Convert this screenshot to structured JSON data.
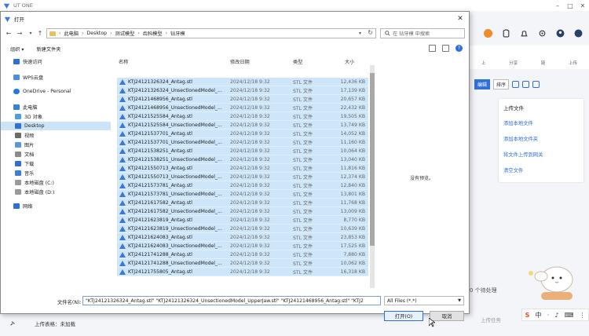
{
  "app": {
    "title": "UT ONE",
    "nav_items": [
      "上",
      "分享",
      "链",
      "上传"
    ],
    "edit_label": "编辑",
    "sort_label": "排序",
    "upload_panel": {
      "title": "上传文件",
      "links": [
        "添加本地文件",
        "添加本地文件夹",
        "将文件上传到网关",
        "清空文件"
      ]
    },
    "status_right": "0 个待处理",
    "bottom_text": "上传表格：未加载",
    "bottom_right": "上传任务",
    "ime": [
      "S",
      "中",
      "·",
      "♪",
      "⌨",
      "⋮"
    ]
  },
  "dialog": {
    "title": "打开",
    "breadcrumbs": [
      "此电脑",
      "Desktop",
      "测试模型",
      "齿科模型",
      "钻牙模"
    ],
    "search_placeholder": "在 钻牙模 中搜索",
    "organize": "组织 ▾",
    "new_folder": "新建文件夹",
    "nav": [
      {
        "label": "快速访问",
        "icon": "star"
      },
      {
        "label": "WPS云盘",
        "icon": "cloud"
      },
      {
        "label": "OneDrive - Personal",
        "icon": "onedrive"
      },
      {
        "label": "此电脑",
        "icon": "pc"
      },
      {
        "label": "3D 对象",
        "icon": "cube"
      },
      {
        "label": "Desktop",
        "icon": "desktop"
      },
      {
        "label": "视频",
        "icon": "video"
      },
      {
        "label": "图片",
        "icon": "image"
      },
      {
        "label": "文档",
        "icon": "doc"
      },
      {
        "label": "下载",
        "icon": "download"
      },
      {
        "label": "音乐",
        "icon": "music"
      },
      {
        "label": "本地磁盘 (C:)",
        "icon": "drive"
      },
      {
        "label": "本地磁盘 (D:)",
        "icon": "drive"
      },
      {
        "label": "网络",
        "icon": "network"
      }
    ],
    "columns": {
      "name": "名称",
      "date": "修改日期",
      "type": "类型",
      "size": "大小"
    },
    "files": [
      {
        "name": "KTJ24121326324_Antag.stl",
        "date": "2024/12/18 9:32",
        "type": "STL 文件",
        "size": "12,436 KB"
      },
      {
        "name": "KTJ24121326324_UnsectionedModel_...",
        "date": "2024/12/18 9:32",
        "type": "STL 文件",
        "size": "17,139 KB"
      },
      {
        "name": "KTJ24121468956_Antag.stl",
        "date": "2024/12/18 9:32",
        "type": "STL 文件",
        "size": "20,657 KB"
      },
      {
        "name": "KTJ24121468956_UnsectionedModel_...",
        "date": "2024/12/18 9:32",
        "type": "STL 文件",
        "size": "22,432 KB"
      },
      {
        "name": "KTJ24121525584_Antag.stl",
        "date": "2024/12/18 9:32",
        "type": "STL 文件",
        "size": "19,505 KB"
      },
      {
        "name": "KTJ24121525584_UnsectionedModel_...",
        "date": "2024/12/18 9:32",
        "type": "STL 文件",
        "size": "13,749 KB"
      },
      {
        "name": "KTJ24121537701_Antag.stl",
        "date": "2024/12/18 9:32",
        "type": "STL 文件",
        "size": "14,052 KB"
      },
      {
        "name": "KTJ24121537701_UnsectionedModel_...",
        "date": "2024/12/18 9:32",
        "type": "STL 文件",
        "size": "11,160 KB"
      },
      {
        "name": "KTJ24121538251_Antag.stl",
        "date": "2024/12/18 9:32",
        "type": "STL 文件",
        "size": "10,064 KB"
      },
      {
        "name": "KTJ24121538251_UnsectionedModel_...",
        "date": "2024/12/18 9:32",
        "type": "STL 文件",
        "size": "13,040 KB"
      },
      {
        "name": "KTJ24121550713_Antag.stl",
        "date": "2024/12/18 9:32",
        "type": "STL 文件",
        "size": "11,816 KB"
      },
      {
        "name": "KTJ24121550713_UnsectionedModel_...",
        "date": "2024/12/18 9:32",
        "type": "STL 文件",
        "size": "12,374 KB"
      },
      {
        "name": "KTJ24121573781_Antag.stl",
        "date": "2024/12/18 9:32",
        "type": "STL 文件",
        "size": "12,840 KB"
      },
      {
        "name": "KTJ24121573781_UnsectionedModel_...",
        "date": "2024/12/18 9:32",
        "type": "STL 文件",
        "size": "13,801 KB"
      },
      {
        "name": "KTJ24121617582_Antag.stl",
        "date": "2024/12/18 9:32",
        "type": "STL 文件",
        "size": "11,768 KB"
      },
      {
        "name": "KTJ24121617582_UnsectionedModel_...",
        "date": "2024/12/18 9:32",
        "type": "STL 文件",
        "size": "13,009 KB"
      },
      {
        "name": "KTJ24121623819_Antag.stl",
        "date": "2024/12/18 9:32",
        "type": "STL 文件",
        "size": "8,770 KB"
      },
      {
        "name": "KTJ24121623819_UnsectionedModel_...",
        "date": "2024/12/18 9:32",
        "type": "STL 文件",
        "size": "10,639 KB"
      },
      {
        "name": "KTJ24121624083_Antag.stl",
        "date": "2024/12/18 9:32",
        "type": "STL 文件",
        "size": "23,853 KB"
      },
      {
        "name": "KTJ24121624083_UnsectionedModel_...",
        "date": "2024/12/18 9:32",
        "type": "STL 文件",
        "size": "17,525 KB"
      },
      {
        "name": "KTJ24121741288_Antag.stl",
        "date": "2024/12/18 9:32",
        "type": "STL 文件",
        "size": "7,880 KB"
      },
      {
        "name": "KTJ24121741288_UnsectionedModel_...",
        "date": "2024/12/18 9:32",
        "type": "STL 文件",
        "size": "10,062 KB"
      },
      {
        "name": "KTJ24121755805_Antag.stl",
        "date": "2024/12/18 9:32",
        "type": "STL 文件",
        "size": "16,318 KB"
      }
    ],
    "preview_text": "没有预览。",
    "filename_label": "文件名(N):",
    "filename_value": "\"KTJ24121326324_Antag.stl\" \"KTJ24121326324_UnsectionedModel_UpperJaw.stl\" \"KTJ24121468956_Antag.stl\" \"KTJ2",
    "filter_value": "All Files (*.*)",
    "open_label": "打开(O)",
    "cancel_label": "取消"
  }
}
